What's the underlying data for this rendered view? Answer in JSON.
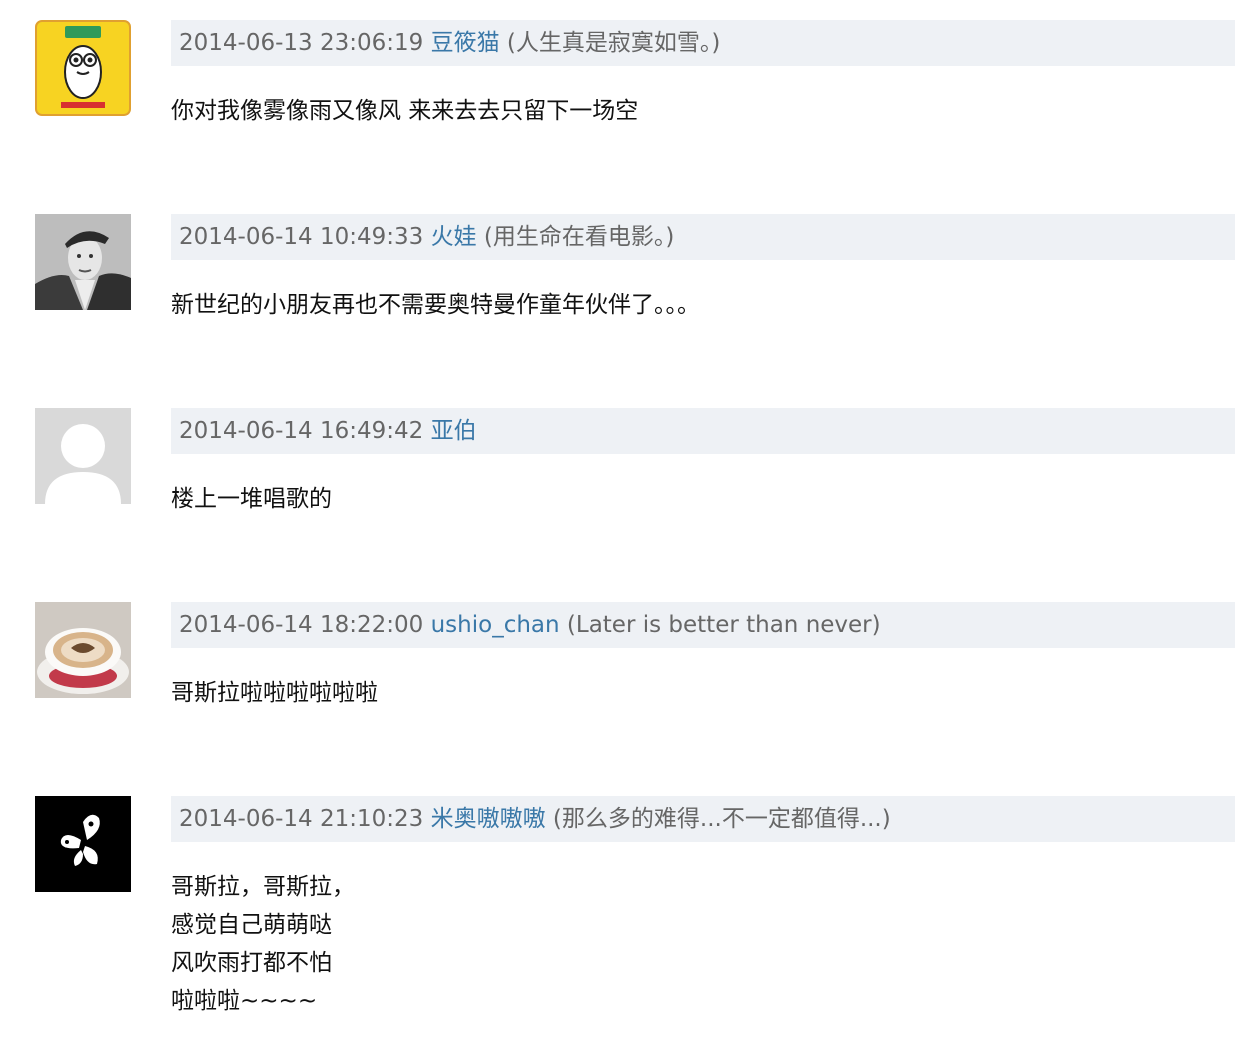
{
  "comments": [
    {
      "time": "2014-06-13 23:06:19",
      "author": "豆筱猫",
      "signature": "(人生真是寂寞如雪。)",
      "lines": [
        "你对我像雾像雨又像风 来来去去只留下一场空"
      ],
      "avatar_icon": "cartoon-penguin-icon"
    },
    {
      "time": "2014-06-14 10:49:33",
      "author": "火娃",
      "signature": "(用生命在看电影。)",
      "lines": [
        "新世纪的小朋友再也不需要奥特曼作童年伙伴了。。。"
      ],
      "avatar_icon": "portrait-photo-icon"
    },
    {
      "time": "2014-06-14 16:49:42",
      "author": "亚伯",
      "signature": "",
      "lines": [
        "楼上一堆唱歌的"
      ],
      "avatar_icon": "default-user-icon"
    },
    {
      "time": "2014-06-14 18:22:00",
      "author": "ushio_chan",
      "signature": "(Later is better than never)",
      "lines": [
        "哥斯拉啦啦啦啦啦啦"
      ],
      "avatar_icon": "coffee-cup-icon"
    },
    {
      "time": "2014-06-14 21:10:23",
      "author": "米奥嗷嗷嗷",
      "signature": "(那么多的难得...不一定都值得...)",
      "lines": [
        "哥斯拉，哥斯拉，",
        "感觉自己萌萌哒",
        "风吹雨打都不怕",
        "啦啦啦~~~~"
      ],
      "avatar_icon": "butterfly-icon"
    }
  ],
  "colors": {
    "meta_bg": "#eef1f5",
    "author_link": "#3a78a8",
    "meta_text": "#666666",
    "body_text": "#111111"
  }
}
